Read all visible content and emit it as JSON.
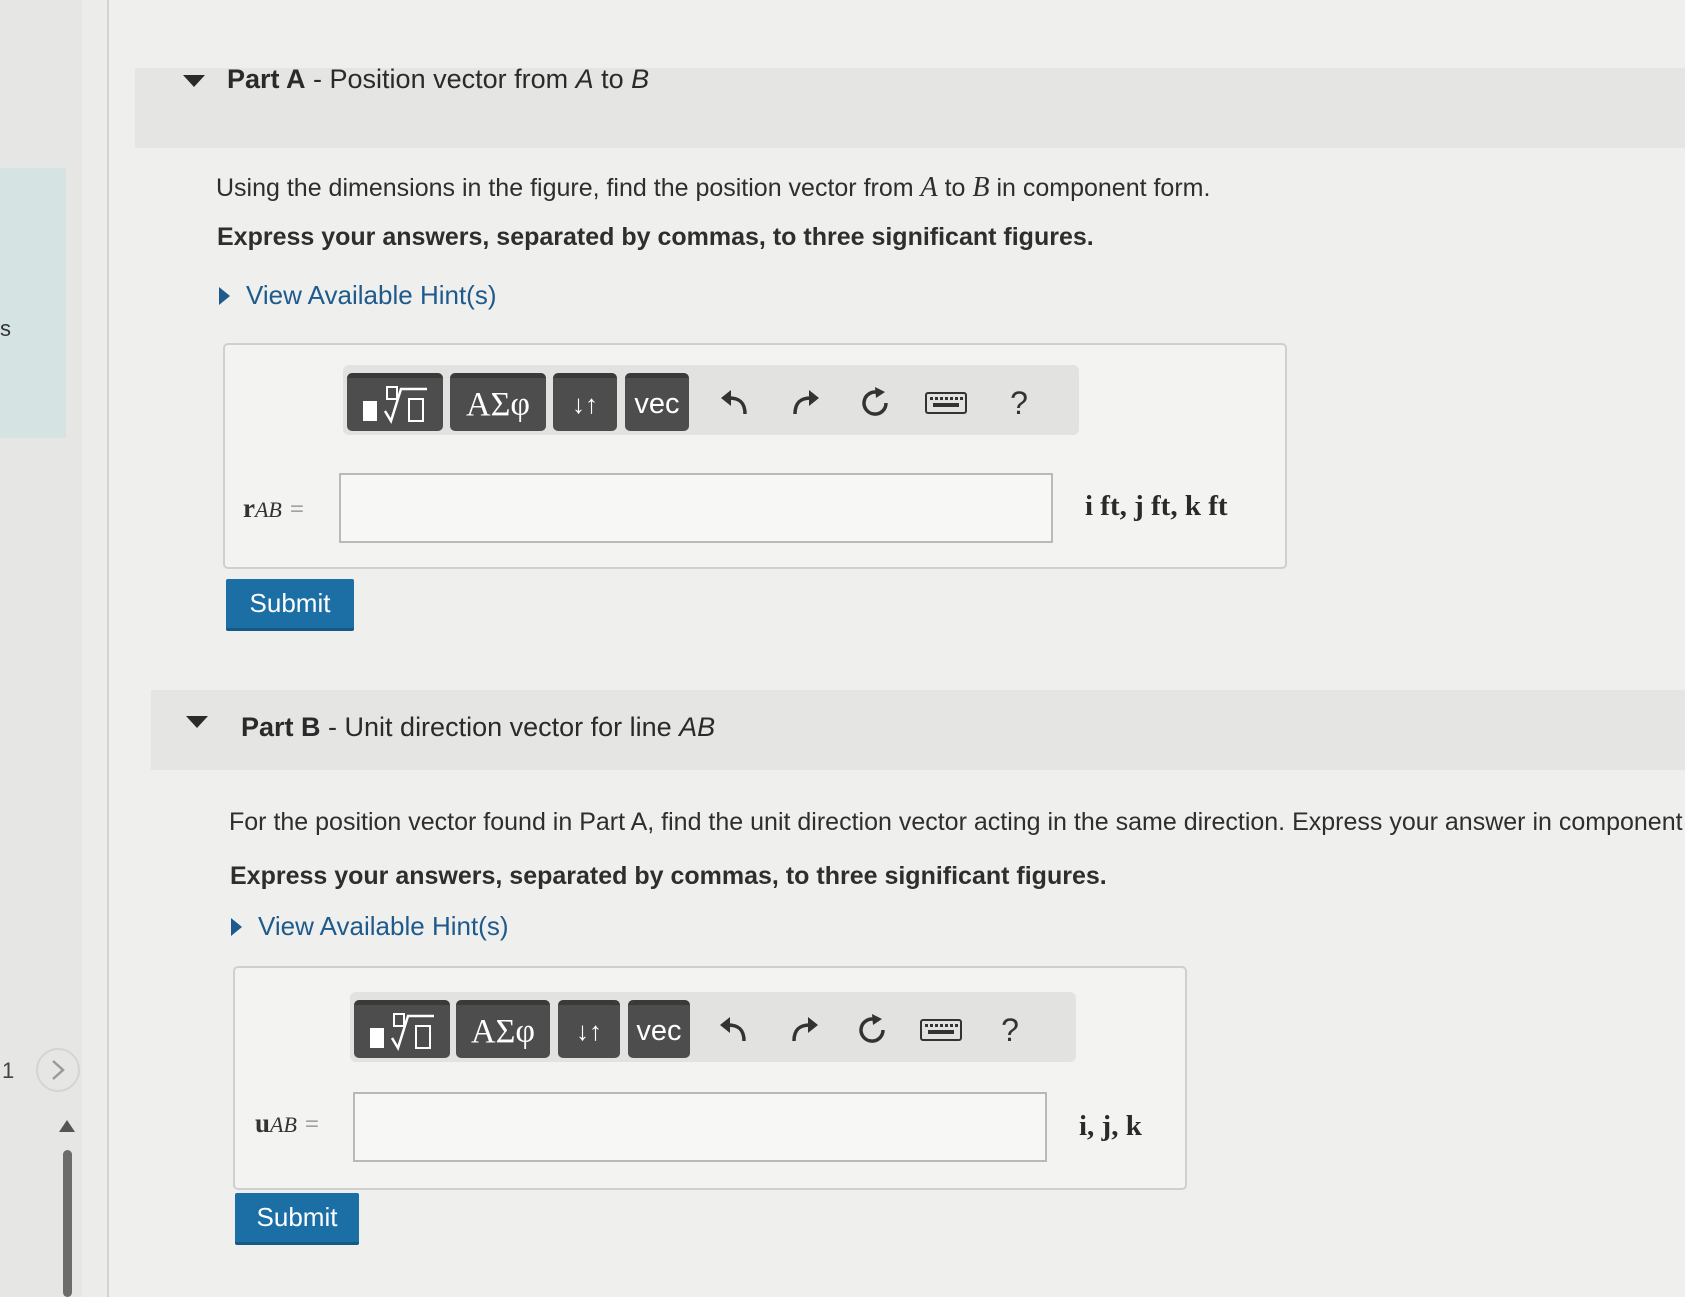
{
  "sidebar": {
    "partial_label": "s",
    "page_number": "1",
    "next_icon": "chevron-right-icon"
  },
  "part_a": {
    "label": "Part A",
    "separator": " - ",
    "title_prefix": "Position vector from ",
    "point_a": "A",
    "title_mid": " to ",
    "point_b": "B",
    "prompt_prefix": "Using the dimensions in the figure, find the position vector from ",
    "prompt_a": "A",
    "prompt_mid": " to ",
    "prompt_b": "B",
    "prompt_suffix": " in component form.",
    "express": "Express your answers, separated by commas, to three significant figures.",
    "hint": "View Available Hint(s)",
    "var_symbol": "r",
    "var_subscript": "AB",
    "equals": "=",
    "input_value": "",
    "units": "i ft, j ft, k ft",
    "submit": "Submit"
  },
  "part_b": {
    "label": "Part B",
    "separator": " - ",
    "title": "Unit direction vector for line ",
    "title_line": "AB",
    "prompt": "For the position vector found in Part A, find the unit direction vector acting in the same direction. Express your answer in component fo",
    "express": "Express your answers, separated by commas, to three significant figures.",
    "hint": "View Available Hint(s)",
    "var_symbol": "u",
    "var_subscript": "AB",
    "equals": "=",
    "input_value": "",
    "units": "i, j, k",
    "submit": "Submit"
  },
  "toolbar": {
    "greek_label": "ΑΣφ",
    "arrows_label": "↓↑",
    "vec_label": "vec",
    "help_label": "?",
    "icons": [
      "templates-icon",
      "undo-icon",
      "redo-icon",
      "reset-icon",
      "keyboard-icon",
      "help-icon"
    ]
  }
}
